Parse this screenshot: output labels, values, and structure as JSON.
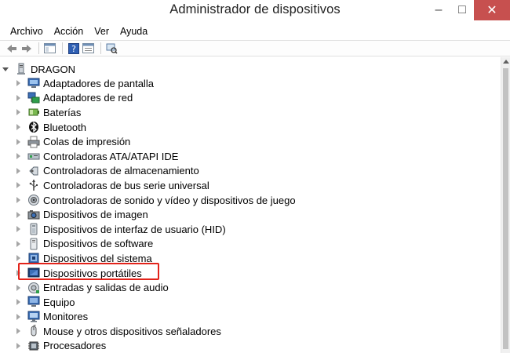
{
  "window": {
    "title": "Administrador de dispositivos",
    "minimize": "–",
    "maximize": "□",
    "close": "✕"
  },
  "menu": [
    "Archivo",
    "Acción",
    "Ver",
    "Ayuda"
  ],
  "tree": {
    "root": "DRAGON",
    "items": [
      {
        "label": "Adaptadores de pantalla",
        "icon": "display-adapter-icon"
      },
      {
        "label": "Adaptadores de red",
        "icon": "network-adapter-icon"
      },
      {
        "label": "Baterías",
        "icon": "battery-icon"
      },
      {
        "label": "Bluetooth",
        "icon": "bluetooth-icon"
      },
      {
        "label": "Colas de impresión",
        "icon": "printer-icon"
      },
      {
        "label": "Controladoras ATA/ATAPI IDE",
        "icon": "ide-controller-icon"
      },
      {
        "label": "Controladoras de almacenamiento",
        "icon": "storage-controller-icon"
      },
      {
        "label": "Controladoras de bus serie universal",
        "icon": "usb-icon"
      },
      {
        "label": "Controladoras de sonido y vídeo y dispositivos de juego",
        "icon": "speaker-icon"
      },
      {
        "label": "Dispositivos de imagen",
        "icon": "camera-icon"
      },
      {
        "label": "Dispositivos de interfaz de usuario (HID)",
        "icon": "hid-icon"
      },
      {
        "label": "Dispositivos de software",
        "icon": "software-device-icon"
      },
      {
        "label": "Dispositivos del sistema",
        "icon": "system-device-icon"
      },
      {
        "label": "Dispositivos portátiles",
        "icon": "portable-device-icon",
        "highlighted": true
      },
      {
        "label": "Entradas y salidas de audio",
        "icon": "audio-io-icon"
      },
      {
        "label": "Equipo",
        "icon": "computer-icon"
      },
      {
        "label": "Monitores",
        "icon": "monitor-icon"
      },
      {
        "label": "Mouse y otros dispositivos señaladores",
        "icon": "mouse-icon"
      },
      {
        "label": "Procesadores",
        "icon": "processor-icon"
      }
    ]
  },
  "colors": {
    "close_button": "#c7504f",
    "highlight_border": "#e2231a"
  }
}
